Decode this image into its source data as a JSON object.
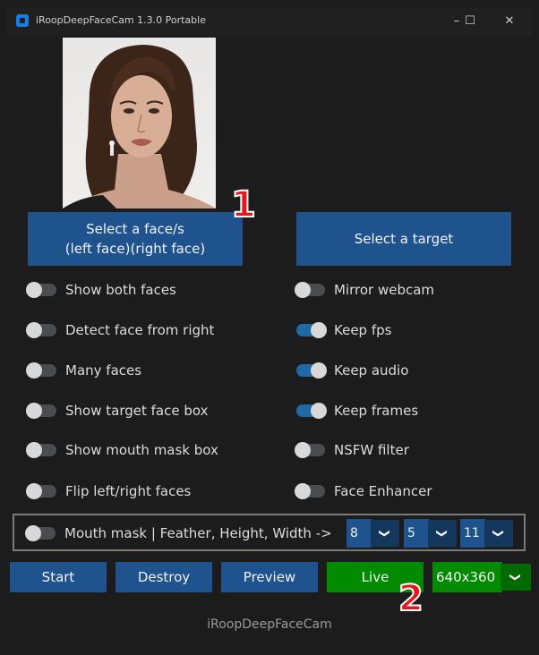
{
  "window": {
    "title": "iRoopDeepFaceCam 1.3.0 Portable",
    "controls": {
      "minimize": "–",
      "maximize": "☐",
      "close": "✕"
    }
  },
  "source_image": {
    "alt": "face photo"
  },
  "buttons": {
    "select_face_line1": "Select a face/s",
    "select_face_line2": "(left face)(right face)",
    "select_target": "Select a target",
    "start": "Start",
    "destroy": "Destroy",
    "preview": "Preview",
    "live": "Live"
  },
  "markers": {
    "one": "1",
    "two": "2"
  },
  "left_toggles": [
    {
      "label": "Show both faces",
      "on": false
    },
    {
      "label": "Detect face from right",
      "on": false
    },
    {
      "label": "Many faces",
      "on": false
    },
    {
      "label": "Show target face box",
      "on": false
    },
    {
      "label": "Show mouth mask box",
      "on": false
    },
    {
      "label": "Flip left/right faces",
      "on": false
    }
  ],
  "right_toggles": [
    {
      "label": "Mirror webcam",
      "on": false
    },
    {
      "label": "Keep fps",
      "on": true
    },
    {
      "label": "Keep audio",
      "on": true
    },
    {
      "label": "Keep frames",
      "on": true
    },
    {
      "label": "NSFW filter",
      "on": false
    },
    {
      "label": "Face Enhancer",
      "on": false
    }
  ],
  "mouth_mask": {
    "label": "Mouth mask | Feather, Height, Width ->",
    "on": false,
    "feather": "8",
    "height": "5",
    "width": "11"
  },
  "resolution": {
    "selected": "640x360"
  },
  "footer": "iRoopDeepFaceCam",
  "colors": {
    "accent_blue": "#1f538d",
    "live_green": "#028a00",
    "background": "#1c1c1c",
    "marker_red": "#e8151b"
  }
}
